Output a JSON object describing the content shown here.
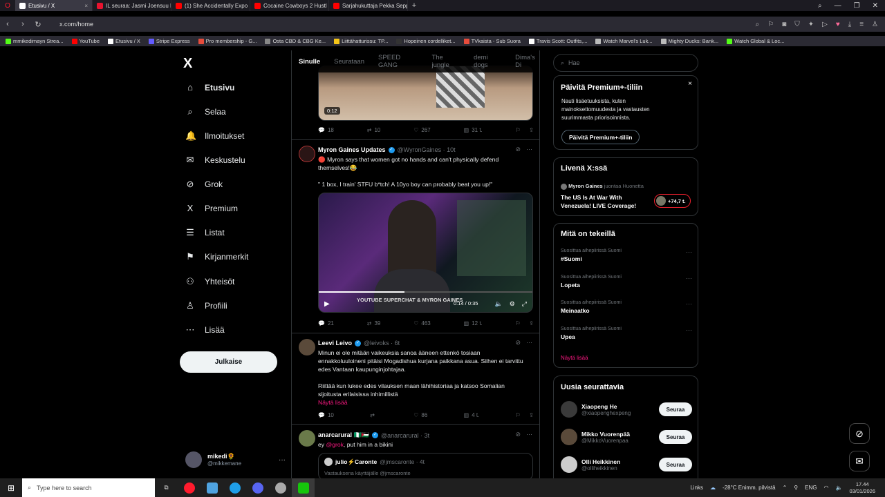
{
  "browser": {
    "tabs": [
      {
        "label": "Etusivu / X",
        "active": true,
        "color": "#ffffff"
      },
      {
        "label": "IL seuraa: Jasmi Joensuu li",
        "active": false,
        "color": "#e8132f"
      },
      {
        "label": "(1) She Accidentally Expo",
        "active": false,
        "color": "#ff0000"
      },
      {
        "label": "Cocaine Cowboys 2 Hustl",
        "active": false,
        "color": "#ff0000"
      },
      {
        "label": "Sarjahukuttaja Pekka Sepp",
        "active": false,
        "color": "#ff0000"
      }
    ],
    "url": "x.com/home",
    "bookmarks": [
      {
        "label": "mmikedimayn Strea...",
        "color": "#53fc18"
      },
      {
        "label": "YouTube",
        "color": "#ff0000"
      },
      {
        "label": "Etusivu / X",
        "color": "#ffffff"
      },
      {
        "label": "Stripe Express",
        "color": "#635bff"
      },
      {
        "label": "Pro membership - G...",
        "color": "#e74c3c"
      },
      {
        "label": "Osta CBD & CBG Ke...",
        "color": "#888888"
      },
      {
        "label": "Liittähatturissu: TP...",
        "color": "#f5c518"
      },
      {
        "label": "Hopeinen cordelliket...",
        "color": "#333333"
      },
      {
        "label": "TVkaista - Sub Suora",
        "color": "#e74c3c"
      },
      {
        "label": "Travis Scott: Outfits,...",
        "color": "#ffffff"
      },
      {
        "label": "Watch Marvel's Luk...",
        "color": "#bbbbbb"
      },
      {
        "label": "Mighty Ducks: Bank...",
        "color": "#bbbbbb"
      },
      {
        "label": "Watch Global & Loc...",
        "color": "#53fc18"
      }
    ]
  },
  "sidebar": {
    "logo": "X",
    "items": [
      {
        "label": "Etusivu",
        "icon": "home-icon",
        "glyph": "⌂"
      },
      {
        "label": "Selaa",
        "icon": "search-icon",
        "glyph": "⌕"
      },
      {
        "label": "Ilmoitukset",
        "icon": "bell-icon",
        "glyph": "🔔"
      },
      {
        "label": "Keskustelu",
        "icon": "mail-icon",
        "glyph": "✉"
      },
      {
        "label": "Grok",
        "icon": "grok-icon",
        "glyph": "⊘"
      },
      {
        "label": "Premium",
        "icon": "x-icon",
        "glyph": "X"
      },
      {
        "label": "Listat",
        "icon": "list-icon",
        "glyph": "☰"
      },
      {
        "label": "Kirjanmerkit",
        "icon": "bookmark-icon",
        "glyph": "⚑"
      },
      {
        "label": "Yhteisöt",
        "icon": "communities-icon",
        "glyph": "⚇"
      },
      {
        "label": "Profiili",
        "icon": "profile-icon",
        "glyph": "♙"
      },
      {
        "label": "Lisää",
        "icon": "more-icon",
        "glyph": "⋯"
      }
    ],
    "post_button": "Julkaise",
    "account": {
      "name": "mikedi🌻",
      "handle": "@mikkemane"
    }
  },
  "feed": {
    "tabs": [
      "Sinulle",
      "Seurataan",
      "SPEED GANG",
      "The jungle",
      "demi dogs",
      "Dima's Di"
    ],
    "tweet0": {
      "video_time": "0:12",
      "replies": "18",
      "reposts": "10",
      "likes": "267",
      "views": "31 t."
    },
    "tweet1": {
      "name": "Myron Gaines Updates",
      "handle": "@WyronGaines · 10t",
      "text1": "🔴 Myron says that women got no hands and can't physically defend themselves!😂",
      "text2": "\" 1 box, I train' STFU b*tch! A 10yo boy can probably beat you up!\"",
      "video_caption": "YOUTUBE SUPERCHAT & MYRON GAINES",
      "video_time": "0:14 / 0:35",
      "replies": "21",
      "reposts": "39",
      "likes": "463",
      "views": "12 t."
    },
    "tweet2": {
      "name": "Leevi Leivo",
      "handle": "@leivoks · 6t",
      "text1": "Minun ei ole mitään vaikeuksia sanoa ääneen ettenkö tosiaan ennakkoluuloineni pitäisi Mogadishua kurjana paikkana asua. Siihen ei tarvittu edes Vantaan kaupunginjohtajaa.",
      "text2": "Riittää kun lukee edes vilauksen maan lähihistoriaa ja katsoo Somalian sijoitusta erilaisissa inhimillistä",
      "show_more": "Näytä lisää",
      "replies": "10",
      "reposts": "",
      "likes": "86",
      "views": "4 t."
    },
    "tweet3": {
      "name": "anarcarural 🇳🇬🇵🇸",
      "handle": "@anarcarural · 3t",
      "text_prefix": "ey ",
      "mention": "@grok",
      "text_suffix": ", put him in a bikini",
      "quote_name": "julio⚡Caronte",
      "quote_handle": "@jmscaronte · 4t",
      "quote_text": "Vastauksena käyttäjälle @jmscaronte"
    }
  },
  "right": {
    "search_placeholder": "Hae",
    "premium": {
      "title": "Päivitä Premium+-tiliin",
      "text": "Nauti lisäetuuksista, kuten mainoksettomuudesta ja vastausten suurimmasta priorisoinnista.",
      "button": "Päivitä Premium+-tiliin"
    },
    "live": {
      "title": "Livenä X:ssä",
      "host": "Myron Gaines",
      "host_suffix": " juontaa Huonetta",
      "topic": "The US Is At War With Venezuela! LIVE Coverage!",
      "count": "+74,7 t."
    },
    "trends": {
      "title": "Mitä on tekeillä",
      "items": [
        {
          "context": "Suosittua aihepiirissä Suomi",
          "name": "#Suomi"
        },
        {
          "context": "Suosittua aihepiirissä Suomi",
          "name": "Lopeta"
        },
        {
          "context": "Suosittua aihepiirissä Suomi",
          "name": "Meinaatko"
        },
        {
          "context": "Suosittua aihepiirissä Suomi",
          "name": "Upea"
        }
      ],
      "show_more": "Näytä lisää"
    },
    "follow": {
      "title": "Uusia seurattavia",
      "items": [
        {
          "name": "Xiaopeng He",
          "handle": "@xiaopenghexpeng",
          "button": "Seuraa"
        },
        {
          "name": "Mikko Vuorenpää",
          "handle": "@MikkoVuorenpaa",
          "button": "Seuraa"
        },
        {
          "name": "Olli Heikkinen",
          "handle": "@olliheikkinen",
          "button": "Seuraa"
        }
      ]
    }
  },
  "taskbar": {
    "search_placeholder": "Type here to search",
    "links": "Links",
    "weather": "-28°C  Enimm. pilvistä",
    "lang": "ENG",
    "time": "17.44",
    "date": "03/01/2026"
  }
}
